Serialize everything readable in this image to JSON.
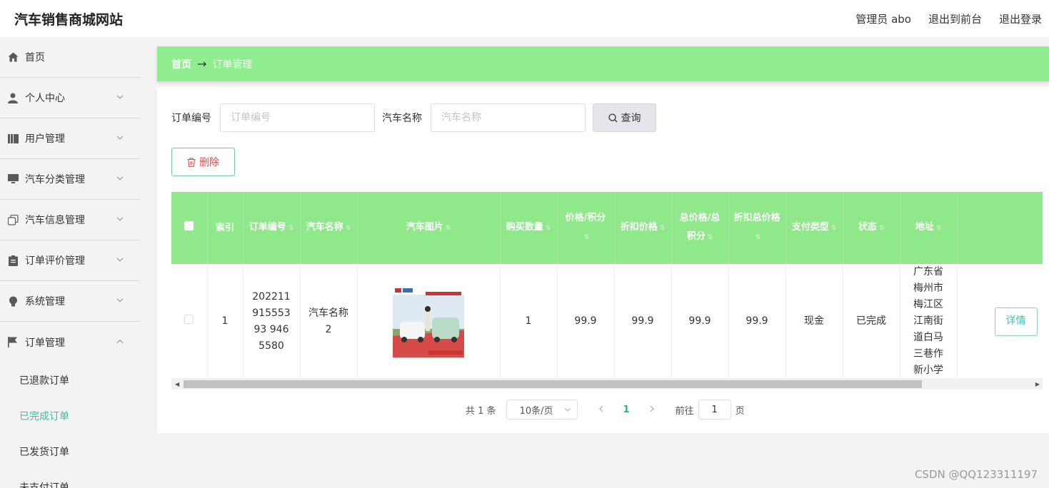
{
  "header": {
    "title": "汽车销售商城网站",
    "admin": "管理员 abo",
    "to_front": "退出到前台",
    "logout": "退出登录"
  },
  "sidebar": {
    "items": [
      {
        "label": "首页",
        "icon": "home-icon"
      },
      {
        "label": "个人中心",
        "icon": "user-icon"
      },
      {
        "label": "用户管理",
        "icon": "book-icon"
      },
      {
        "label": "汽车分类管理",
        "icon": "monitor-icon"
      },
      {
        "label": "汽车信息管理",
        "icon": "copy-icon"
      },
      {
        "label": "订单评价管理",
        "icon": "clipboard-icon"
      },
      {
        "label": "系统管理",
        "icon": "bulb-icon"
      },
      {
        "label": "订单管理",
        "icon": "flag-icon"
      }
    ],
    "sub_items": [
      {
        "label": "已退款订单"
      },
      {
        "label": "已完成订单"
      },
      {
        "label": "已发货订单"
      },
      {
        "label": "未支付订单"
      }
    ]
  },
  "breadcrumb": {
    "home": "首页",
    "arrow": "→",
    "current": "订单管理"
  },
  "search": {
    "order_label": "订单编号",
    "order_placeholder": "订单编号",
    "car_label": "汽车名称",
    "car_placeholder": "汽车名称",
    "query_label": "查询"
  },
  "toolbar": {
    "delete_label": "删除"
  },
  "table": {
    "columns": [
      "索引",
      "订单编号",
      "汽车名称",
      "汽车图片",
      "购买数量",
      "价格/积分",
      "折扣价格",
      "总价格/总积分",
      "折扣总价格",
      "支付类型",
      "状态",
      "地址"
    ],
    "rows": [
      {
        "index": "1",
        "order_no": "20221191555393 9465580",
        "car_name": "汽车名称2",
        "quantity": "1",
        "price": "99.9",
        "discount_price": "99.9",
        "total": "99.9",
        "discount_total": "99.9",
        "pay_type": "现金",
        "status": "已完成",
        "address": "广东省梅州市梅江区江南街道白马三巷作新小学",
        "detail_label": "详情"
      }
    ]
  },
  "pagination": {
    "total": "共 1 条",
    "page_size": "10条/页",
    "current": "1",
    "goto_prefix": "前往",
    "goto_value": "1",
    "goto_suffix": "页"
  },
  "watermark": "CSDN @QQ123311197",
  "colors": {
    "accent_green": "#90ee90",
    "active_text": "#3cbf9a",
    "delete_red": "#e04b4b"
  }
}
